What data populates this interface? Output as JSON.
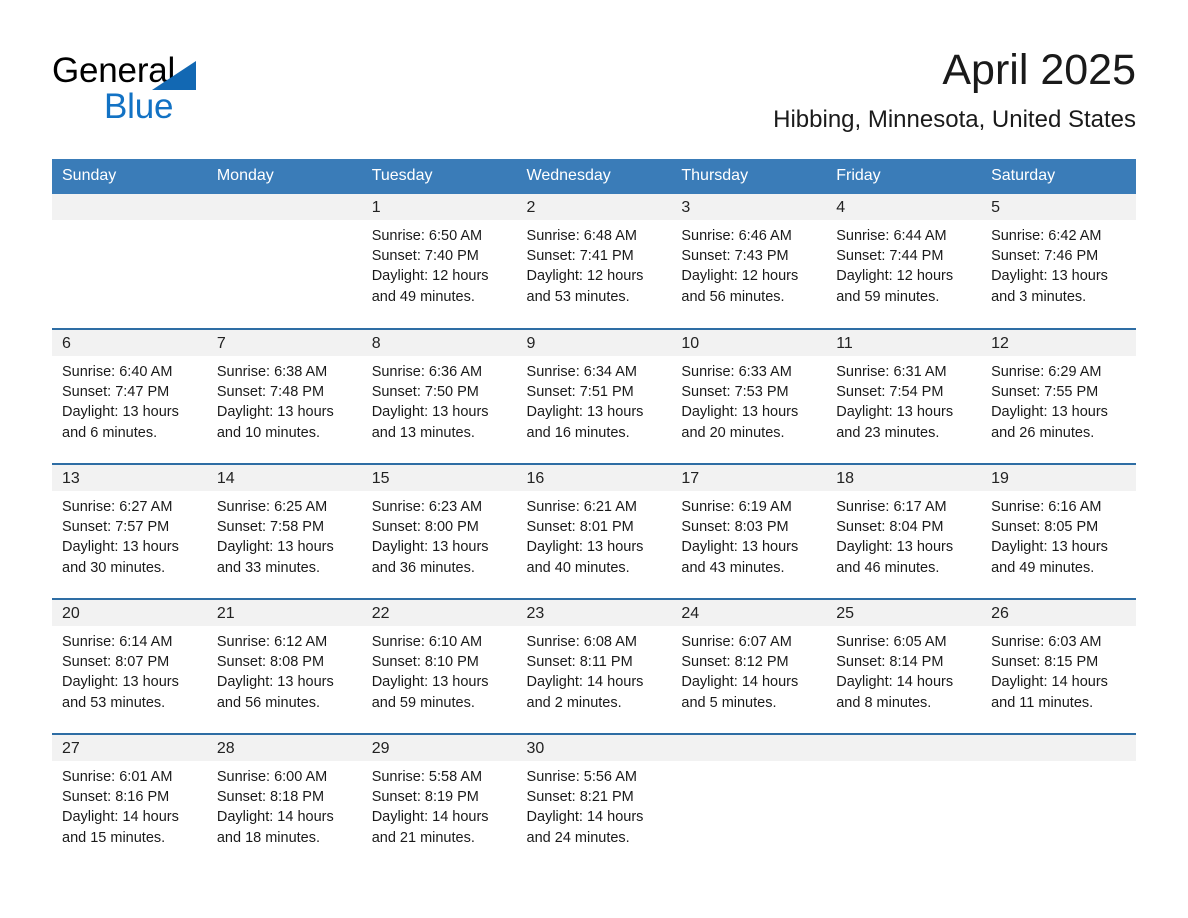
{
  "brand": {
    "logo_line1": "General",
    "logo_line2": "Blue",
    "accent_color": "#1272c4",
    "triangle_color": "#1268b3",
    "triangle_icon": "triangle-icon"
  },
  "header": {
    "month_title": "April 2025",
    "location": "Hibbing, Minnesota, United States"
  },
  "calendar": {
    "header_bg": "#3a7cb8",
    "row_border_color": "#2e6da4",
    "daynum_bg": "#f2f2f2",
    "weekday_headers": [
      "Sunday",
      "Monday",
      "Tuesday",
      "Wednesday",
      "Thursday",
      "Friday",
      "Saturday"
    ],
    "weeks": [
      [
        {
          "day": "",
          "blank": true,
          "lines": []
        },
        {
          "day": "",
          "blank": true,
          "lines": []
        },
        {
          "day": "1",
          "blank": false,
          "lines": [
            "Sunrise: 6:50 AM",
            "Sunset: 7:40 PM",
            "Daylight: 12 hours",
            "and 49 minutes."
          ]
        },
        {
          "day": "2",
          "blank": false,
          "lines": [
            "Sunrise: 6:48 AM",
            "Sunset: 7:41 PM",
            "Daylight: 12 hours",
            "and 53 minutes."
          ]
        },
        {
          "day": "3",
          "blank": false,
          "lines": [
            "Sunrise: 6:46 AM",
            "Sunset: 7:43 PM",
            "Daylight: 12 hours",
            "and 56 minutes."
          ]
        },
        {
          "day": "4",
          "blank": false,
          "lines": [
            "Sunrise: 6:44 AM",
            "Sunset: 7:44 PM",
            "Daylight: 12 hours",
            "and 59 minutes."
          ]
        },
        {
          "day": "5",
          "blank": false,
          "lines": [
            "Sunrise: 6:42 AM",
            "Sunset: 7:46 PM",
            "Daylight: 13 hours",
            "and 3 minutes."
          ]
        }
      ],
      [
        {
          "day": "6",
          "blank": false,
          "lines": [
            "Sunrise: 6:40 AM",
            "Sunset: 7:47 PM",
            "Daylight: 13 hours",
            "and 6 minutes."
          ]
        },
        {
          "day": "7",
          "blank": false,
          "lines": [
            "Sunrise: 6:38 AM",
            "Sunset: 7:48 PM",
            "Daylight: 13 hours",
            "and 10 minutes."
          ]
        },
        {
          "day": "8",
          "blank": false,
          "lines": [
            "Sunrise: 6:36 AM",
            "Sunset: 7:50 PM",
            "Daylight: 13 hours",
            "and 13 minutes."
          ]
        },
        {
          "day": "9",
          "blank": false,
          "lines": [
            "Sunrise: 6:34 AM",
            "Sunset: 7:51 PM",
            "Daylight: 13 hours",
            "and 16 minutes."
          ]
        },
        {
          "day": "10",
          "blank": false,
          "lines": [
            "Sunrise: 6:33 AM",
            "Sunset: 7:53 PM",
            "Daylight: 13 hours",
            "and 20 minutes."
          ]
        },
        {
          "day": "11",
          "blank": false,
          "lines": [
            "Sunrise: 6:31 AM",
            "Sunset: 7:54 PM",
            "Daylight: 13 hours",
            "and 23 minutes."
          ]
        },
        {
          "day": "12",
          "blank": false,
          "lines": [
            "Sunrise: 6:29 AM",
            "Sunset: 7:55 PM",
            "Daylight: 13 hours",
            "and 26 minutes."
          ]
        }
      ],
      [
        {
          "day": "13",
          "blank": false,
          "lines": [
            "Sunrise: 6:27 AM",
            "Sunset: 7:57 PM",
            "Daylight: 13 hours",
            "and 30 minutes."
          ]
        },
        {
          "day": "14",
          "blank": false,
          "lines": [
            "Sunrise: 6:25 AM",
            "Sunset: 7:58 PM",
            "Daylight: 13 hours",
            "and 33 minutes."
          ]
        },
        {
          "day": "15",
          "blank": false,
          "lines": [
            "Sunrise: 6:23 AM",
            "Sunset: 8:00 PM",
            "Daylight: 13 hours",
            "and 36 minutes."
          ]
        },
        {
          "day": "16",
          "blank": false,
          "lines": [
            "Sunrise: 6:21 AM",
            "Sunset: 8:01 PM",
            "Daylight: 13 hours",
            "and 40 minutes."
          ]
        },
        {
          "day": "17",
          "blank": false,
          "lines": [
            "Sunrise: 6:19 AM",
            "Sunset: 8:03 PM",
            "Daylight: 13 hours",
            "and 43 minutes."
          ]
        },
        {
          "day": "18",
          "blank": false,
          "lines": [
            "Sunrise: 6:17 AM",
            "Sunset: 8:04 PM",
            "Daylight: 13 hours",
            "and 46 minutes."
          ]
        },
        {
          "day": "19",
          "blank": false,
          "lines": [
            "Sunrise: 6:16 AM",
            "Sunset: 8:05 PM",
            "Daylight: 13 hours",
            "and 49 minutes."
          ]
        }
      ],
      [
        {
          "day": "20",
          "blank": false,
          "lines": [
            "Sunrise: 6:14 AM",
            "Sunset: 8:07 PM",
            "Daylight: 13 hours",
            "and 53 minutes."
          ]
        },
        {
          "day": "21",
          "blank": false,
          "lines": [
            "Sunrise: 6:12 AM",
            "Sunset: 8:08 PM",
            "Daylight: 13 hours",
            "and 56 minutes."
          ]
        },
        {
          "day": "22",
          "blank": false,
          "lines": [
            "Sunrise: 6:10 AM",
            "Sunset: 8:10 PM",
            "Daylight: 13 hours",
            "and 59 minutes."
          ]
        },
        {
          "day": "23",
          "blank": false,
          "lines": [
            "Sunrise: 6:08 AM",
            "Sunset: 8:11 PM",
            "Daylight: 14 hours",
            "and 2 minutes."
          ]
        },
        {
          "day": "24",
          "blank": false,
          "lines": [
            "Sunrise: 6:07 AM",
            "Sunset: 8:12 PM",
            "Daylight: 14 hours",
            "and 5 minutes."
          ]
        },
        {
          "day": "25",
          "blank": false,
          "lines": [
            "Sunrise: 6:05 AM",
            "Sunset: 8:14 PM",
            "Daylight: 14 hours",
            "and 8 minutes."
          ]
        },
        {
          "day": "26",
          "blank": false,
          "lines": [
            "Sunrise: 6:03 AM",
            "Sunset: 8:15 PM",
            "Daylight: 14 hours",
            "and 11 minutes."
          ]
        }
      ],
      [
        {
          "day": "27",
          "blank": false,
          "lines": [
            "Sunrise: 6:01 AM",
            "Sunset: 8:16 PM",
            "Daylight: 14 hours",
            "and 15 minutes."
          ]
        },
        {
          "day": "28",
          "blank": false,
          "lines": [
            "Sunrise: 6:00 AM",
            "Sunset: 8:18 PM",
            "Daylight: 14 hours",
            "and 18 minutes."
          ]
        },
        {
          "day": "29",
          "blank": false,
          "lines": [
            "Sunrise: 5:58 AM",
            "Sunset: 8:19 PM",
            "Daylight: 14 hours",
            "and 21 minutes."
          ]
        },
        {
          "day": "30",
          "blank": false,
          "lines": [
            "Sunrise: 5:56 AM",
            "Sunset: 8:21 PM",
            "Daylight: 14 hours",
            "and 24 minutes."
          ]
        },
        {
          "day": "",
          "blank": true,
          "lines": []
        },
        {
          "day": "",
          "blank": true,
          "lines": []
        },
        {
          "day": "",
          "blank": true,
          "lines": []
        }
      ]
    ]
  }
}
